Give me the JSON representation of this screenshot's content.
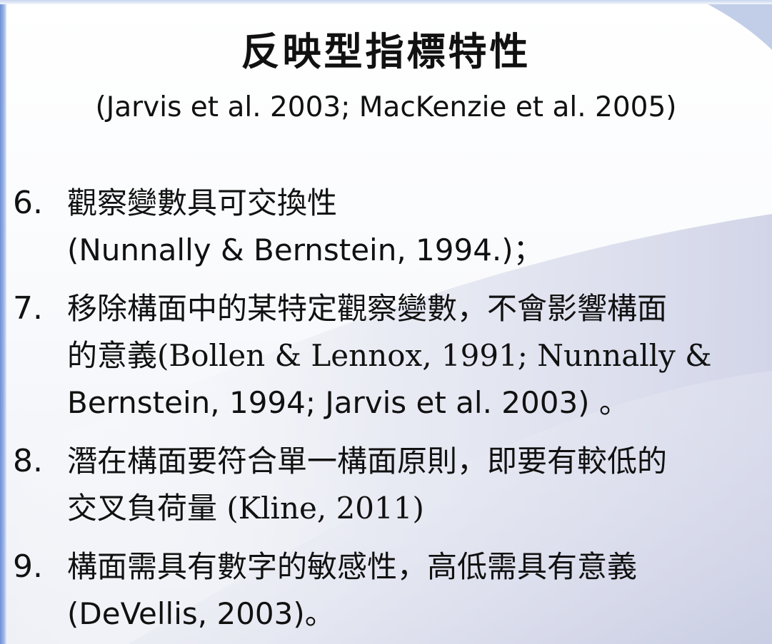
{
  "slide": {
    "title": "反映型指標特性",
    "subtitle": "(Jarvis et al. 2003; MacKenzie et al. 2005)",
    "items": [
      {
        "number": "6.",
        "lines": [
          "觀察變數具可交換性",
          "(Nunnally & Bernstein, 1994.)；"
        ]
      },
      {
        "number": "7.",
        "lines": [
          "移除構面中的某特定觀察變數，不會影響構面",
          "的意義(Bollen & Lennox, 1991; Nunnally &",
          "Bernstein, 1994; Jarvis et al. 2003) 。"
        ]
      },
      {
        "number": "8.",
        "lines": [
          "潛在構面要符合單一構面原則，即要有較低的",
          "交叉負荷量 (Kline, 2011)"
        ]
      },
      {
        "number": "9.",
        "lines": [
          "構面需具有數字的敏感性，高低需具有意義",
          "(DeVellis, 2003)。"
        ]
      }
    ]
  },
  "colors": {
    "text": "#111111",
    "accent_bar": "#6d8fd4",
    "background_swoosh": "#d9dced"
  }
}
